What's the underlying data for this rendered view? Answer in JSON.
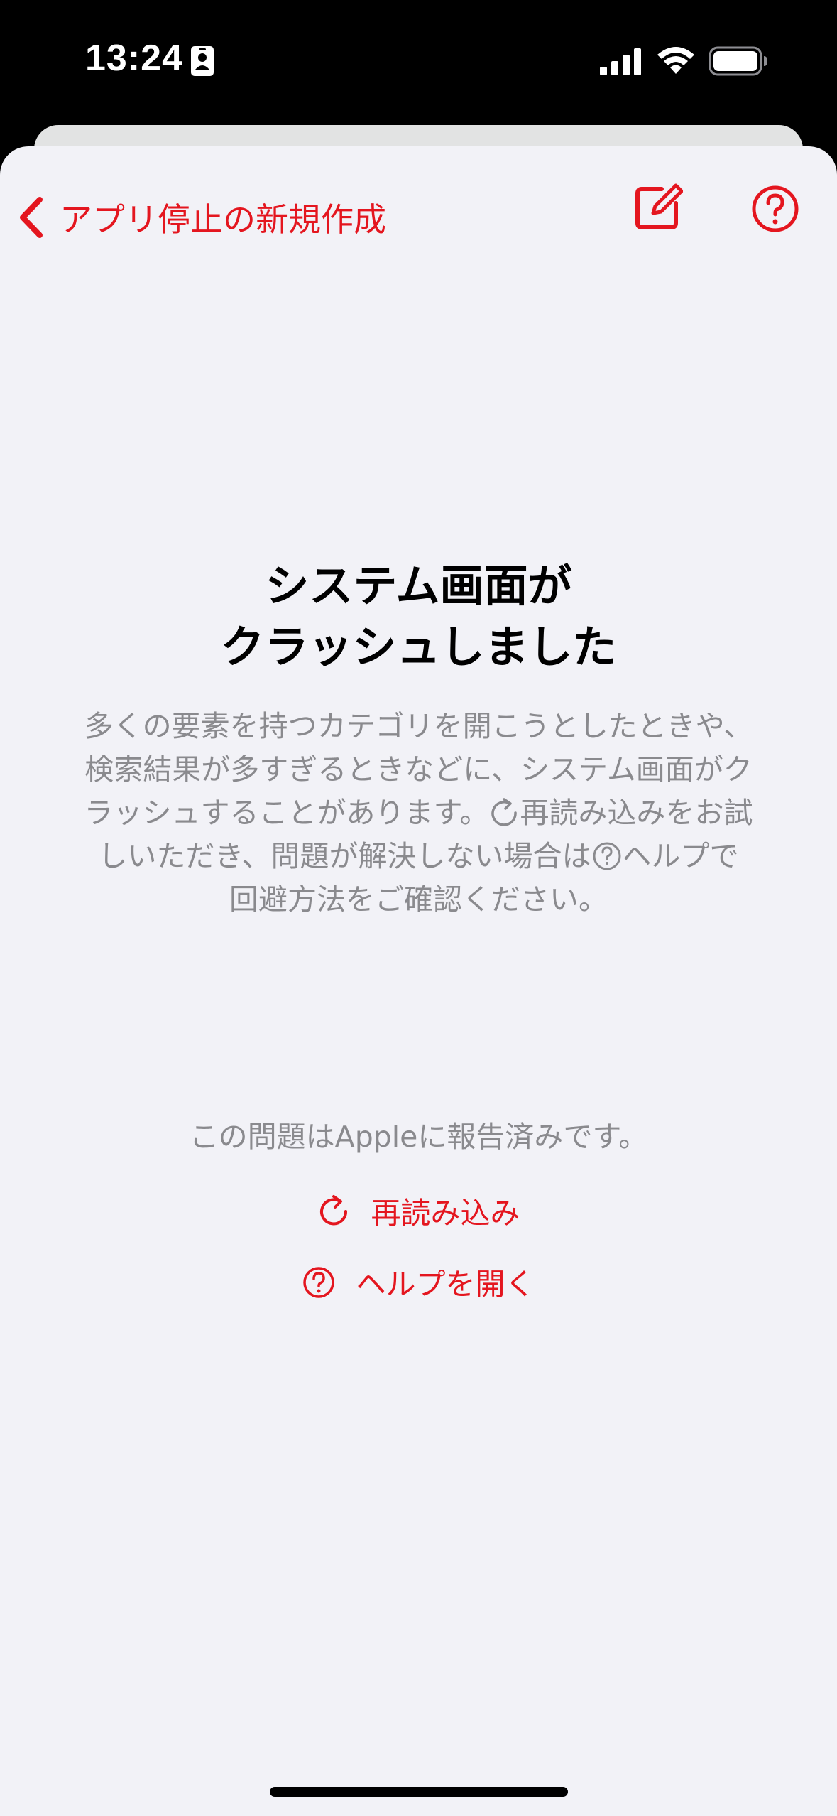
{
  "status_bar": {
    "time": "13:24"
  },
  "nav": {
    "back_label": "アプリ停止の新規作成",
    "icons": {
      "back": "chevron-left-icon",
      "compose": "compose-icon",
      "help": "question-circle-icon"
    }
  },
  "error": {
    "title_line1": "システム画面が",
    "title_line2": "クラッシュしました",
    "message_line1": "多くの要素を持つカテゴリを開こうとしたときや、",
    "message_line2": "検索結果が多すぎるときなどに、システム画面がク",
    "message_line3a": "ラッシュすることがあります。",
    "message_line3b": "再読み込みをお試",
    "message_line4a": "しいただき、問題が解決しない場合は",
    "message_line4b": "ヘルプで",
    "message_line5": "回避方法をご確認ください。",
    "report": "この問題はAppleに報告済みです。"
  },
  "actions": {
    "reload_label": "再読み込み",
    "help_label": "ヘルプを開く"
  },
  "colors": {
    "accent": "#e4161f",
    "secondary_text": "#8a8a8e",
    "background": "#f2f2f7"
  }
}
